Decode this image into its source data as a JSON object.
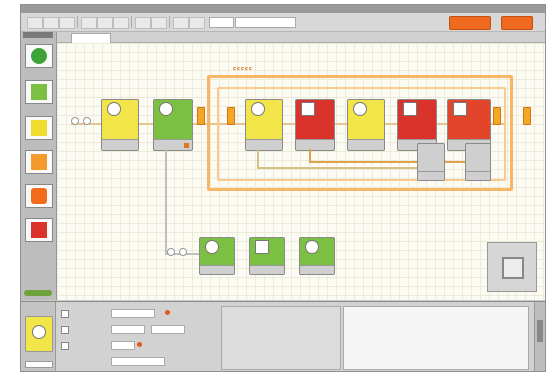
{
  "window": {
    "title": ""
  },
  "canvas": {
    "tab_label": ""
  },
  "loop": {
    "label": "ccccc"
  },
  "palette": {
    "items": [
      {
        "name": "common-palette-item-green",
        "icon": "green-circle-icon",
        "color": "#3ea43a"
      },
      {
        "name": "common-palette-item-action",
        "icon": "action-block-icon",
        "color": "#7cc043"
      },
      {
        "name": "common-palette-item-sensor",
        "icon": "sensor-block-icon",
        "color": "#f1dd2e"
      },
      {
        "name": "common-palette-item-flow",
        "icon": "flow-block-icon",
        "color": "#f59b2d"
      },
      {
        "name": "common-palette-item-data",
        "icon": "data-block-icon",
        "color": "#f26a1b"
      },
      {
        "name": "common-palette-item-advanced",
        "icon": "advanced-block-icon",
        "color": "#d9332c"
      }
    ]
  },
  "toolbar": {
    "dropdown_1": "",
    "dropdown_2": ""
  },
  "config_panel": {
    "title": "",
    "rows": [
      {
        "label": "",
        "value": ""
      },
      {
        "label": "",
        "value": ""
      },
      {
        "label": "",
        "value": ""
      }
    ]
  },
  "colors": {
    "orange_accent": "#f5a623",
    "loop_frame": "#f7b665",
    "sensor_yellow": "#f1e54a",
    "motor_green": "#7cc043",
    "display_red": "#d9332c",
    "canvas_bg": "#fbfaf3"
  }
}
